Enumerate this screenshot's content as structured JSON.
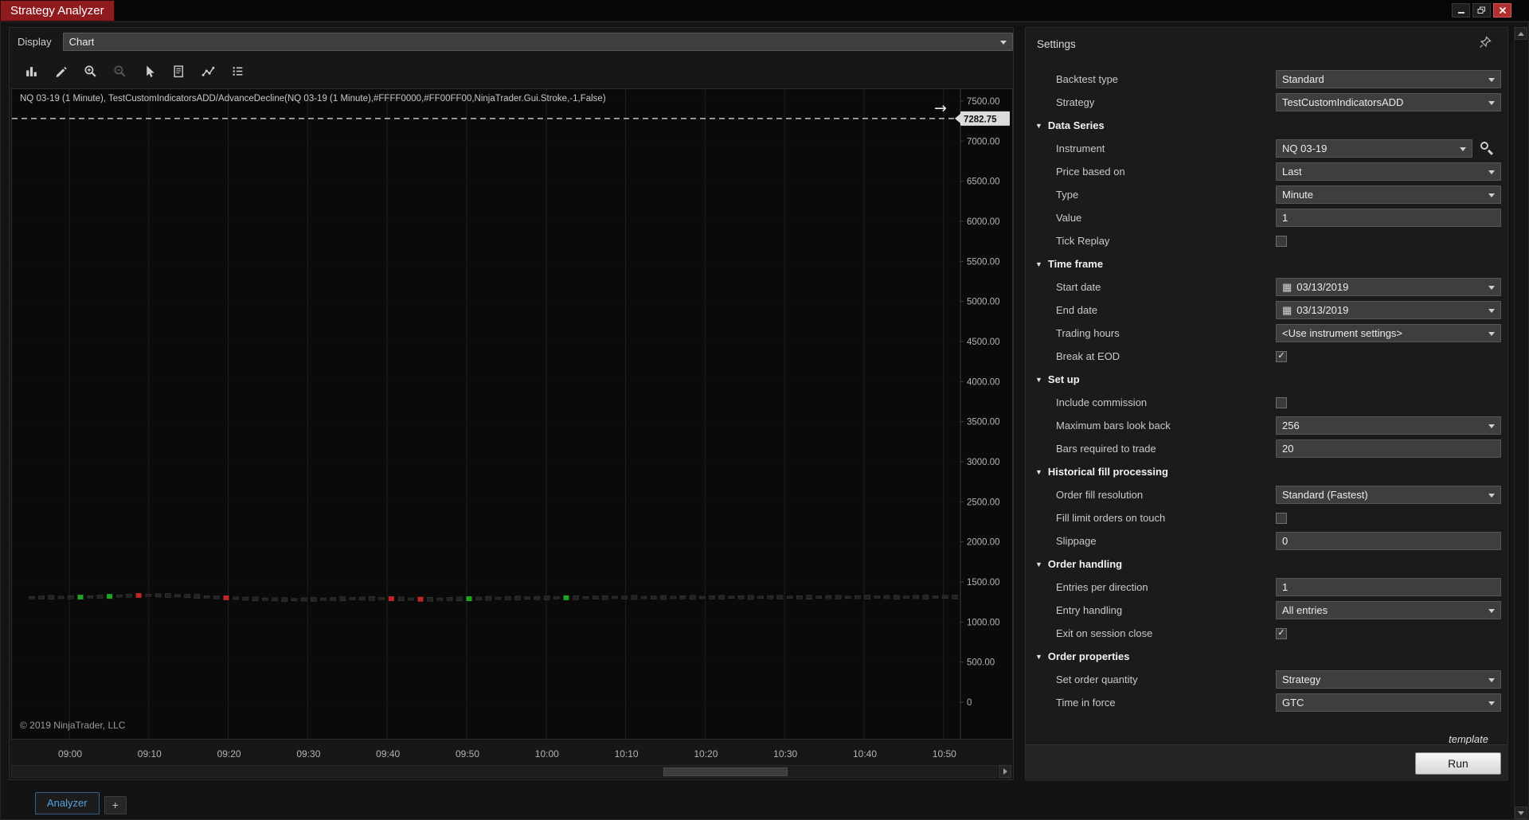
{
  "window": {
    "title": "Strategy Analyzer"
  },
  "colors": {
    "title_bar_red": "#8f1b1e",
    "tab_accent_blue": "#4fa3e3",
    "candle_up": "#1fa51f",
    "candle_down": "#c22525",
    "price_line": "#e8e8e8"
  },
  "left_panel": {
    "display_label": "Display",
    "display_value": "Chart",
    "toolbar": [
      {
        "icon": "bar-chart-icon",
        "disabled": false
      },
      {
        "icon": "pencil-icon",
        "disabled": false
      },
      {
        "icon": "zoom-in-icon",
        "disabled": false
      },
      {
        "icon": "zoom-out-icon",
        "disabled": true
      },
      {
        "icon": "cursor-icon",
        "disabled": false
      },
      {
        "icon": "report-icon",
        "disabled": false
      },
      {
        "icon": "polyline-icon",
        "disabled": false
      },
      {
        "icon": "list-icon",
        "disabled": false
      }
    ]
  },
  "chart": {
    "header": "NQ 03-19 (1 Minute), TestCustomIndicatorsADD/AdvanceDecline(NQ 03-19 (1 Minute),#FFFF0000,#FF00FF00,NinjaTrader.Gui.Stroke,-1,False)",
    "price_marker": {
      "label": "7282.75"
    },
    "copyright": "© 2019 NinjaTrader, LLC",
    "y_range": [
      0,
      7500
    ],
    "y_ticks": [
      "7500.00",
      "7000.00",
      "6500.00",
      "6000.00",
      "5500.00",
      "5000.00",
      "4500.00",
      "4000.00",
      "3500.00",
      "3000.00",
      "2500.00",
      "2000.00",
      "1500.00",
      "1000.00",
      "500.00",
      "0"
    ],
    "x_ticks": [
      "09:00",
      "09:10",
      "09:20",
      "09:30",
      "09:40",
      "09:50",
      "10:00",
      "10:10",
      "10:20",
      "10:30",
      "10:40",
      "10:50"
    ],
    "series": {
      "prices": [
        1305,
        1306,
        1308,
        1307,
        1309,
        1311,
        1313,
        1316,
        1320,
        1324,
        1328,
        1332,
        1334,
        1333,
        1331,
        1328,
        1324,
        1319,
        1314,
        1308,
        1302,
        1297,
        1292,
        1288,
        1285,
        1283,
        1281,
        1280,
        1282,
        1284,
        1286,
        1288,
        1290,
        1292,
        1293,
        1294,
        1293,
        1291,
        1289,
        1287,
        1285,
        1284,
        1285,
        1287,
        1289,
        1291,
        1293,
        1295,
        1296,
        1297,
        1298,
        1299,
        1300,
        1301,
        1302,
        1303,
        1303,
        1304,
        1305,
        1304,
        1306,
        1305,
        1307,
        1306,
        1305,
        1306,
        1307,
        1308,
        1307,
        1306,
        1307,
        1308,
        1309,
        1308,
        1307,
        1308,
        1309,
        1310,
        1309,
        1308,
        1309,
        1310,
        1311,
        1310,
        1309,
        1310,
        1311,
        1312,
        1311,
        1310,
        1311,
        1312,
        1311,
        1312,
        1313,
        1312
      ],
      "colors": "nnnnngnngnnrnnnnnnnnrnnnnnnnnnnnnnnnnrnnrnnnngnnnnnnnnngnnnnnnnnnnnnnnnnnnnnnnnnnnnnnnnnnnnnnnnn"
    }
  },
  "settings": {
    "title": "Settings",
    "template_label": "template",
    "run_label": "Run",
    "rows": [
      {
        "label": "Backtest type",
        "control": "dropdown",
        "value": "Standard"
      },
      {
        "label": "Strategy",
        "control": "dropdown",
        "value": "TestCustomIndicatorsADD"
      },
      {
        "label": "Data Series",
        "control": "section"
      },
      {
        "label": "Instrument",
        "control": "dropdown-search",
        "value": "NQ 03-19"
      },
      {
        "label": "Price based on",
        "control": "dropdown",
        "value": "Last"
      },
      {
        "label": "Type",
        "control": "dropdown",
        "value": "Minute"
      },
      {
        "label": "Value",
        "control": "input",
        "value": "1"
      },
      {
        "label": "Tick Replay",
        "control": "checkbox",
        "value": false
      },
      {
        "label": "Time frame",
        "control": "section"
      },
      {
        "label": "Start date",
        "control": "datepicker",
        "value": "03/13/2019"
      },
      {
        "label": "End date",
        "control": "datepicker",
        "value": "03/13/2019"
      },
      {
        "label": "Trading hours",
        "control": "dropdown",
        "value": "<Use instrument settings>"
      },
      {
        "label": "Break at EOD",
        "control": "checkbox",
        "value": true
      },
      {
        "label": "Set up",
        "control": "section"
      },
      {
        "label": "Include commission",
        "control": "checkbox",
        "value": false
      },
      {
        "label": "Maximum bars look back",
        "control": "dropdown",
        "value": "256"
      },
      {
        "label": "Bars required to trade",
        "control": "input",
        "value": "20"
      },
      {
        "label": "Historical fill processing",
        "control": "section"
      },
      {
        "label": "Order fill resolution",
        "control": "dropdown",
        "value": "Standard (Fastest)"
      },
      {
        "label": "Fill limit orders on touch",
        "control": "checkbox",
        "value": false
      },
      {
        "label": "Slippage",
        "control": "input",
        "value": "0"
      },
      {
        "label": "Order handling",
        "control": "section"
      },
      {
        "label": "Entries per direction",
        "control": "input",
        "value": "1"
      },
      {
        "label": "Entry handling",
        "control": "dropdown",
        "value": "All entries"
      },
      {
        "label": "Exit on session close",
        "control": "checkbox",
        "value": true
      },
      {
        "label": "Order properties",
        "control": "section"
      },
      {
        "label": "Set order quantity",
        "control": "dropdown",
        "value": "Strategy"
      },
      {
        "label": "Time in force",
        "control": "dropdown",
        "value": "GTC"
      }
    ]
  },
  "tabs": [
    {
      "label": "Analyzer",
      "active": true
    },
    {
      "label": "+",
      "active": false
    }
  ]
}
